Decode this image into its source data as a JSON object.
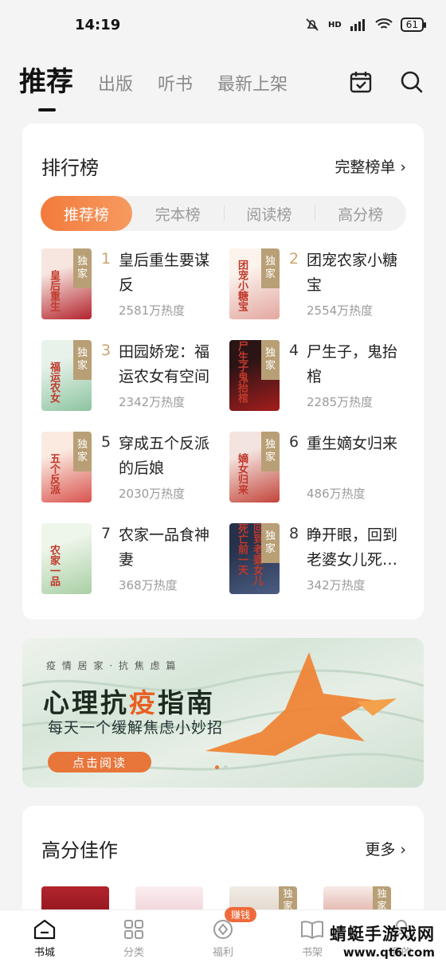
{
  "status": {
    "time": "14:19",
    "network": "HD",
    "battery": "61"
  },
  "top_tabs": [
    "推荐",
    "出版",
    "听书",
    "最新上架"
  ],
  "ranking": {
    "title": "排行榜",
    "more": "完整榜单 ›",
    "segments": [
      "推荐榜",
      "完本榜",
      "阅读榜",
      "高分榜"
    ],
    "badge": "独家",
    "books": [
      {
        "rank": "1",
        "title": "皇后重生要谋反",
        "heat": "2581万热度",
        "cover_text": "皇后重生",
        "colors": [
          "#f7e6e0",
          "#b3232d"
        ]
      },
      {
        "rank": "2",
        "title": "团宠农家小糖宝",
        "heat": "2554万热度",
        "cover_text": "团宠小糖宝",
        "colors": [
          "#fbf3ec",
          "#e3a7a0"
        ]
      },
      {
        "rank": "3",
        "title": "田园娇宠：福运农女有空间",
        "heat": "2342万热度",
        "cover_text": "福运农女",
        "colors": [
          "#e7f2ea",
          "#8cc4a0"
        ]
      },
      {
        "rank": "4",
        "title": "尸生子，鬼抬棺",
        "heat": "2285万热度",
        "cover_text": "尸生子鬼抬棺",
        "colors": [
          "#2a1415",
          "#a51d1d"
        ]
      },
      {
        "rank": "5",
        "title": "穿成五个反派的后娘",
        "heat": "2030万热度",
        "cover_text": "五个反派",
        "colors": [
          "#fbeae0",
          "#d9534f"
        ]
      },
      {
        "rank": "6",
        "title": "重生嫡女归来",
        "heat": "486万热度",
        "cover_text": "嫡女归来",
        "colors": [
          "#f4e4df",
          "#c2443a"
        ]
      },
      {
        "rank": "7",
        "title": "农家一品食神妻",
        "heat": "368万热度",
        "cover_text": "农家一品",
        "colors": [
          "#eef5ea",
          "#a8cfa3"
        ]
      },
      {
        "rank": "8",
        "title": "睁开眼，回到老婆女儿死…",
        "heat": "342万热度",
        "cover_text": "回到老婆女儿死亡前一天",
        "colors": [
          "#26314a",
          "#4b5d82"
        ]
      }
    ]
  },
  "banner": {
    "sub": "疫 情 居 家 · 抗 焦 虑 篇",
    "headline_pre": "心理抗",
    "headline_hl": "疫",
    "headline_post": "指南",
    "desc": "每天一个缓解焦虑小妙招",
    "cta": "点击阅读"
  },
  "highscore": {
    "title": "高分佳作",
    "more": "更多 ›"
  },
  "bottom_nav": [
    {
      "label": "书城",
      "active": true
    },
    {
      "label": "分类",
      "active": false
    },
    {
      "label": "福利",
      "active": false,
      "badge": "赚钱"
    },
    {
      "label": "书架",
      "active": false
    },
    {
      "label": "我的",
      "active": false
    }
  ],
  "watermark": {
    "line1": "蜻蜓手游戏网",
    "line2": "www.qt6.com"
  }
}
